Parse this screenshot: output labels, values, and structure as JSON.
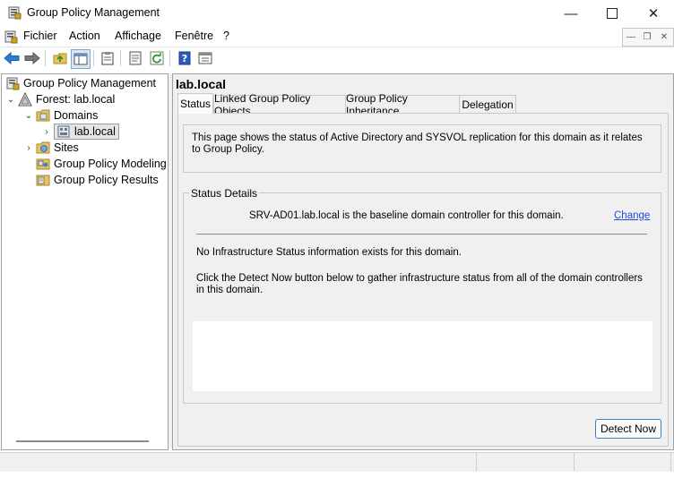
{
  "window": {
    "title": "Group Policy Management"
  },
  "menu": {
    "items": [
      "Fichier",
      "Action",
      "Affichage",
      "Fenêtre",
      "?"
    ]
  },
  "toolbar": {
    "icons": [
      "back-arrow-icon",
      "forward-arrow-icon",
      "up-folder-icon",
      "show-hide-tree-icon",
      "clipboard-icon",
      "properties-icon",
      "refresh-icon",
      "help-icon",
      "view-icon"
    ]
  },
  "tree": {
    "root": "Group Policy Management",
    "forest": "Forest: lab.local",
    "domains": "Domains",
    "domain": "lab.local",
    "sites": "Sites",
    "modeling": "Group Policy Modeling",
    "results": "Group Policy Results"
  },
  "main": {
    "title": "lab.local",
    "tabs": [
      "Status",
      "Linked Group Policy Objects",
      "Group Policy Inheritance",
      "Delegation"
    ],
    "active_tab": "Status",
    "info_text": "This page shows the status of Active Directory and SYSVOL replication for this domain as it relates to Group Policy.",
    "status_details_label": "Status Details",
    "baseline_text": "SRV-AD01.lab.local is the baseline domain controller for this domain.",
    "change_link": "Change",
    "no_info_text": "No Infrastructure Status information exists for this domain.",
    "detect_text": "Click the Detect Now button below to gather infrastructure status from all of the domain controllers in this domain.",
    "detect_button": "Detect Now"
  },
  "colors": {
    "link": "#1a4fd6",
    "pane_bg": "#f0f0f0",
    "selection": "#e5e5e5"
  }
}
